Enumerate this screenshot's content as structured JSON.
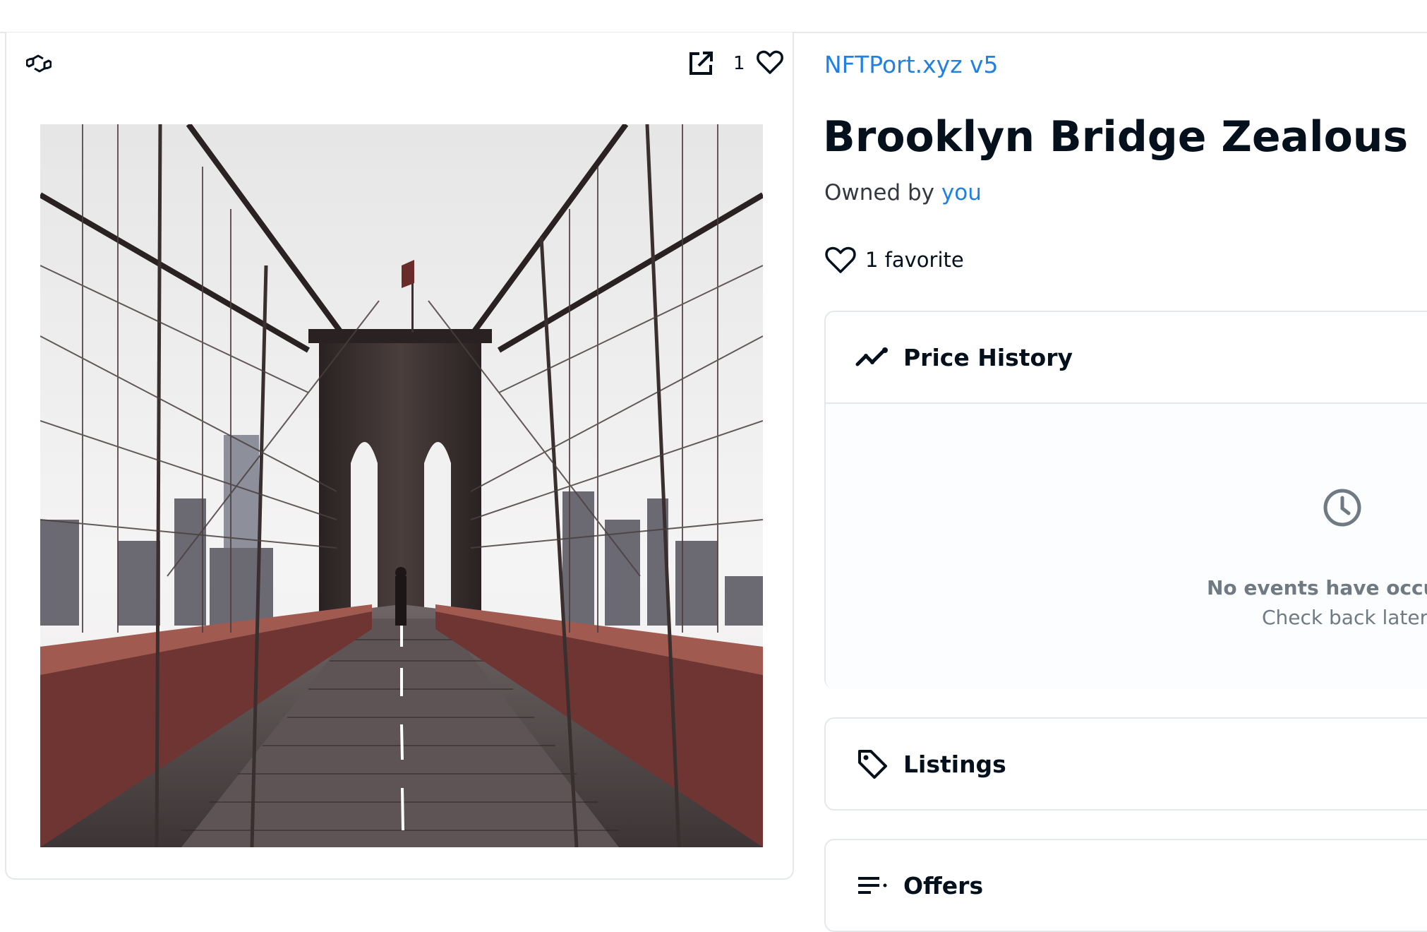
{
  "media": {
    "chain_icon": "polygon-icon",
    "external_link_icon": "open-in-new-icon",
    "favorite_count": "1",
    "heart_icon": "heart-outline-icon",
    "image_subject": "Brooklyn Bridge walkway"
  },
  "item": {
    "collection_name": "NFTPort.xyz v5",
    "title": "Brooklyn Bridge Zealous",
    "owned_by_label": "Owned by",
    "owner": "you",
    "favorites_label": "1 favorite"
  },
  "panels": {
    "price_history": {
      "title": "Price History",
      "icon": "trending-icon",
      "empty_icon": "clock-icon",
      "empty_title": "No events have occurre",
      "empty_subtitle": "Check back later."
    },
    "listings": {
      "title": "Listings",
      "icon": "tag-icon"
    },
    "offers": {
      "title": "Offers",
      "icon": "list-icon"
    }
  },
  "colors": {
    "link": "#2081e2",
    "text": "#04111d",
    "muted": "#707a83",
    "border": "#e5e8eb"
  }
}
